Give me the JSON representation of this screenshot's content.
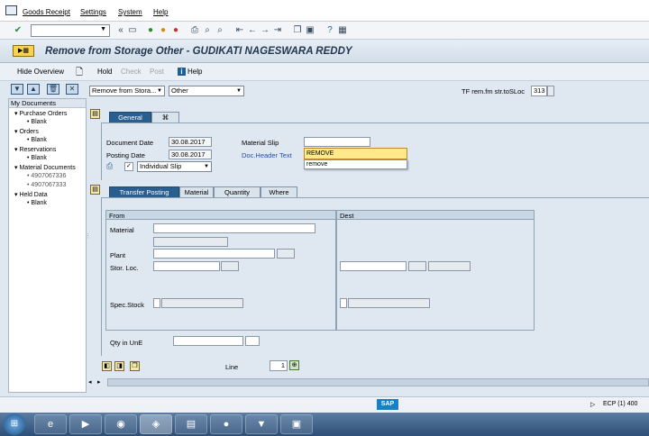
{
  "menu": {
    "items": [
      "Goods Receipt",
      "Settings",
      "System",
      "Help"
    ]
  },
  "toolbar": {
    "command_value": "",
    "icons": [
      "enter-icon",
      "save-icon",
      "back-icon",
      "exit-icon",
      "cancel-icon",
      "print-icon",
      "find-icon",
      "find-next-icon",
      "first-page-icon",
      "prev-page-icon",
      "next-page-icon",
      "last-page-icon",
      "new-session-icon",
      "shortcut-icon",
      "help-icon",
      "layout-icon"
    ]
  },
  "title": "Remove from Storage Other - GUDIKATI NAGESWARA REDDY",
  "app_toolbar": {
    "hide_overview": "Hide Overview",
    "hold": "Hold",
    "check": "Check",
    "post": "Post",
    "help": "Help"
  },
  "header_row": {
    "transaction": "Remove from Stora...",
    "reference": "Other",
    "movement_label": "TF rem.fm str.toSLoc",
    "movement_type": "313"
  },
  "tree": {
    "header": "My Documents",
    "nodes": [
      {
        "label": "Purchase Orders",
        "children": [
          "Blank"
        ]
      },
      {
        "label": "Orders",
        "children": [
          "Blank"
        ]
      },
      {
        "label": "Reservations",
        "children": [
          "Blank"
        ]
      },
      {
        "label": "Material Documents",
        "children": [
          "4907067336",
          "4907067333"
        ]
      },
      {
        "label": "Held Data",
        "children": [
          "Blank"
        ]
      }
    ]
  },
  "general_tabs": [
    "General",
    "⌘"
  ],
  "general": {
    "document_date_label": "Document Date",
    "document_date": "30.08.2017",
    "posting_date_label": "Posting Date",
    "posting_date": "30.08.2017",
    "print_checked": "✓",
    "slip_type": "Individual Slip",
    "material_slip_label": "Material Slip",
    "material_slip": "",
    "header_text_label": "Doc.Header Text",
    "header_text": "REMOVE",
    "suggestion": "remove"
  },
  "detail_tabs": [
    "Transfer Posting",
    "Material",
    "Quantity",
    "Where"
  ],
  "transfer": {
    "from_label": "From",
    "dest_label": "Dest",
    "material_label": "Material",
    "plant_label": "Plant",
    "stor_loc_label": "Stor. Loc.",
    "spec_stock_label": "Spec.Stock",
    "qty_label": "Qty in UnE",
    "line_label": "Line",
    "line_value": "1"
  },
  "status": {
    "sap_logo": "SAP",
    "system": "ECP (1) 400"
  },
  "taskbar": {
    "apps": [
      "start-button",
      "internet-explorer",
      "media-player",
      "chrome",
      "sap-logon",
      "file-explorer",
      "app-red",
      "app-blue",
      "app-image"
    ]
  },
  "colors": {
    "title_bg": "#dae4ee",
    "active_tab": "#2a5e8e",
    "taskbar": "#3a5f88"
  }
}
